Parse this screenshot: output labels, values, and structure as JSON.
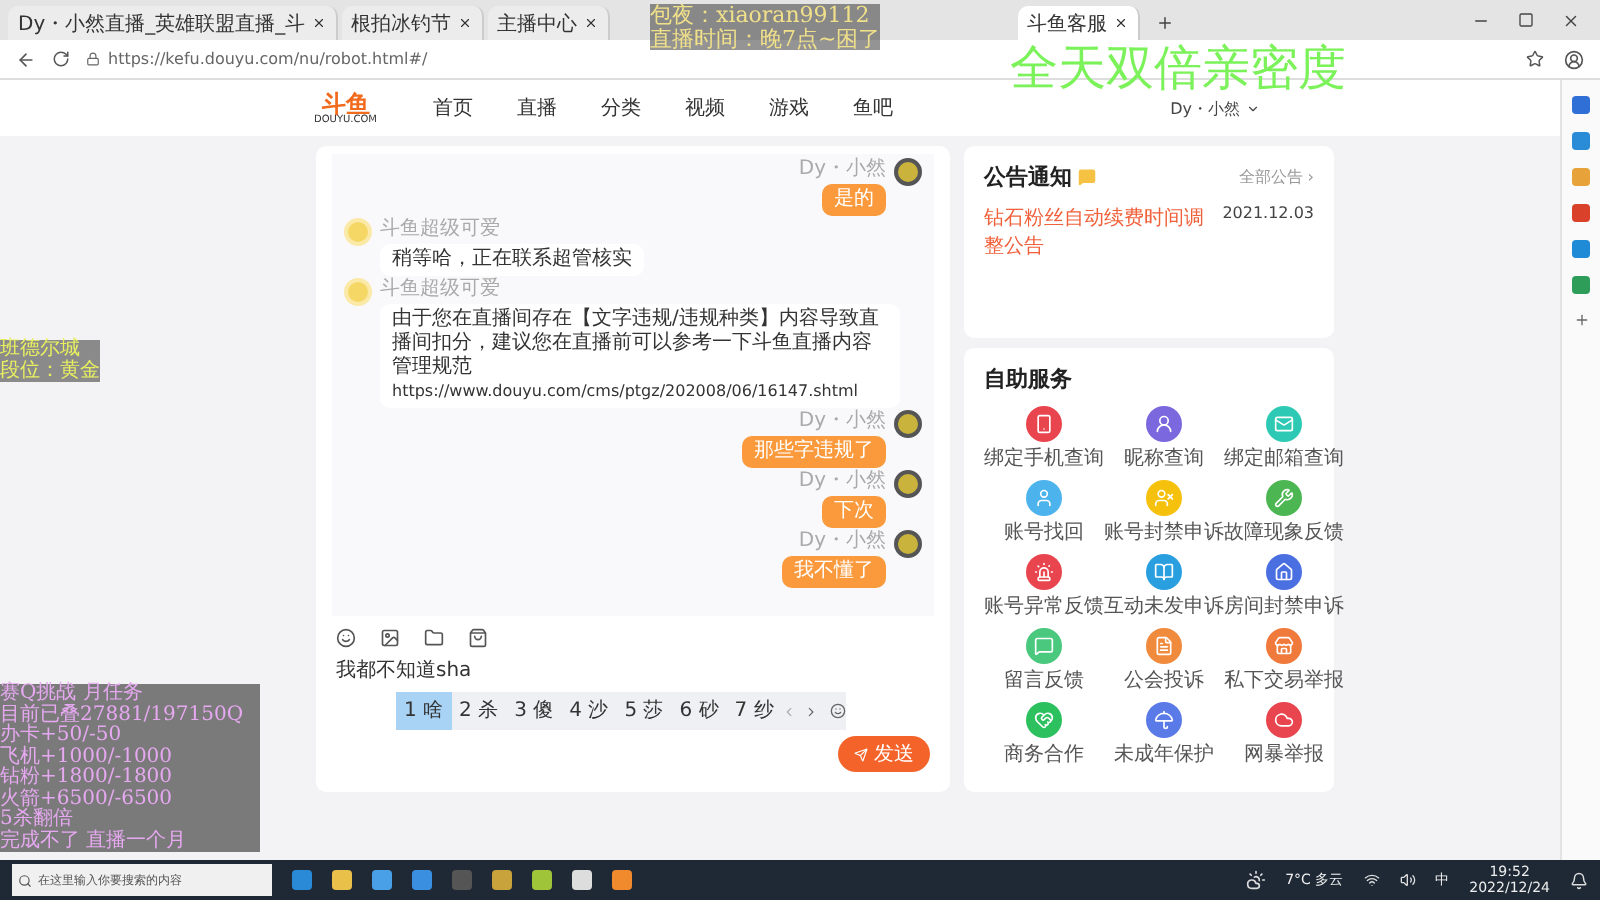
{
  "browser": {
    "tabs": [
      {
        "title": "Dy・小然直播_英雄联盟直播_斗",
        "selected": false
      },
      {
        "title": "根拍冰钓节",
        "selected": false
      },
      {
        "title": "主播中心",
        "selected": false
      },
      {
        "title": "斗鱼客服",
        "selected": true
      }
    ],
    "url": "https://kefu.douyu.com/nu/robot.html#/"
  },
  "header": {
    "logo": {
      "text": "斗鱼",
      "sub": "DOUYU.COM"
    },
    "nav": [
      "首页",
      "直播",
      "分类",
      "视频",
      "游戏",
      "鱼吧"
    ],
    "user": "Dy・小然"
  },
  "chat": {
    "messages": [
      {
        "kind": "self",
        "sender": "Dy・小然",
        "text": "是的"
      },
      {
        "kind": "agent",
        "sender": "斗鱼超级可爱",
        "text": "稍等哈，正在联系超管核实"
      },
      {
        "kind": "agent",
        "sender": "斗鱼超级可爱",
        "text": "由于您在直播间存在【文字违规/违规种类】内容导致直播间扣分，建议您在直播前可以参考一下斗鱼直播内容管理规范",
        "link": "https://www.douyu.com/cms/ptgz/202008/06/16147.shtml"
      },
      {
        "kind": "self",
        "sender": "Dy・小然",
        "text": "那些字违规了"
      },
      {
        "kind": "self",
        "sender": "Dy・小然",
        "text": "下次"
      },
      {
        "kind": "self",
        "sender": "Dy・小然",
        "text": "我不懂了"
      }
    ],
    "input": "我都不知道sha",
    "candidates": [
      {
        "label": "1 啥",
        "selected": true
      },
      {
        "label": "2 杀",
        "selected": false
      },
      {
        "label": "3 傻",
        "selected": false
      },
      {
        "label": "4 沙",
        "selected": false
      },
      {
        "label": "5 莎",
        "selected": false
      },
      {
        "label": "6 砂",
        "selected": false
      },
      {
        "label": "7 纱",
        "selected": false
      }
    ],
    "send": "发送"
  },
  "notice": {
    "title": "公告通知",
    "more": "全部公告 ›",
    "items": [
      {
        "text": "钻石粉丝自动续费时间调整公告",
        "date": "2021.12.03"
      }
    ]
  },
  "services": {
    "title": "自助服务",
    "items": [
      {
        "label": "绑定手机查询",
        "color": "#e8454f"
      },
      {
        "label": "昵称查询",
        "color": "#7b68de"
      },
      {
        "label": "绑定邮箱查询",
        "color": "#2ec9b5"
      },
      {
        "label": "账号找回",
        "color": "#4db3ec"
      },
      {
        "label": "账号封禁申诉",
        "color": "#f5c10d"
      },
      {
        "label": "故障现象反馈",
        "color": "#4cb752"
      },
      {
        "label": "账号异常反馈",
        "color": "#e8454f"
      },
      {
        "label": "互动未发申诉",
        "color": "#2a9fe0"
      },
      {
        "label": "房间封禁申诉",
        "color": "#4a6fe0"
      },
      {
        "label": "留言反馈",
        "color": "#49c87e"
      },
      {
        "label": "公会投诉",
        "color": "#f08a3c"
      },
      {
        "label": "私下交易举报",
        "color": "#f07a3c"
      },
      {
        "label": "商务合作",
        "color": "#2cc05e"
      },
      {
        "label": "未成年保护",
        "color": "#5a7ae8"
      },
      {
        "label": "网暴举报",
        "color": "#e8454f"
      }
    ]
  },
  "overlays": {
    "contact": "包夜：xiaoran99112",
    "schedule": "直播时间：晚7点~困了",
    "slogan": "全天双倍亲密度",
    "rank": [
      "班德尔城",
      "段位：黄金"
    ],
    "tasks": [
      "赛Q挑战 月任务",
      "目前已叠27881/197150Q",
      "办卡+50/-50",
      "飞机+1000/-1000",
      "钻粉+1800/-1800",
      "火箭+6500/-6500",
      "5杀翻倍",
      "完成不了 直播一个月"
    ]
  },
  "taskbar": {
    "search": "在这里输入你要搜索的内容",
    "weather": "7°C 多云",
    "ime": "中",
    "time": "19:52",
    "date": "2022/12/24"
  }
}
